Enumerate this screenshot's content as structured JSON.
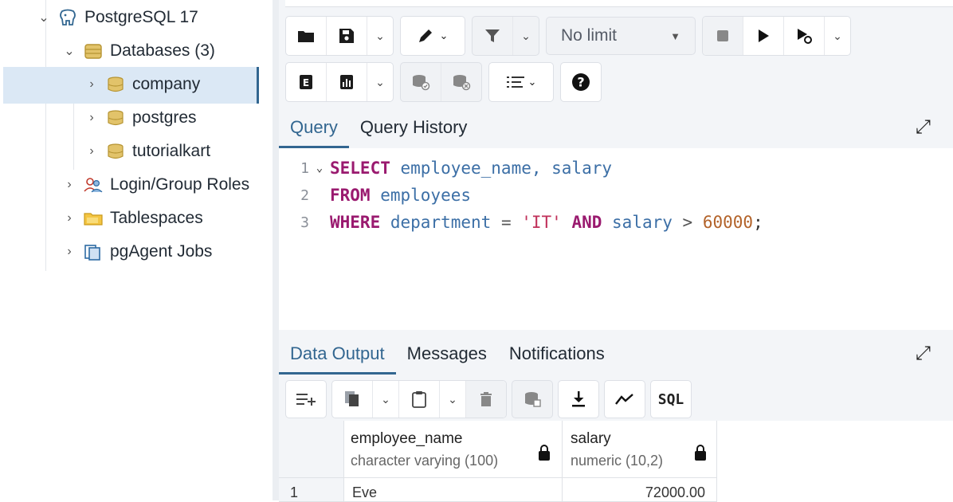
{
  "tree": {
    "server": "PostgreSQL 17",
    "databases": "Databases (3)",
    "db_items": [
      "company",
      "postgres",
      "tutorialkart"
    ],
    "login_roles": "Login/Group Roles",
    "tablespaces": "Tablespaces",
    "pgagent": "pgAgent Jobs"
  },
  "toolbar": {
    "limit": "No limit",
    "help": "?"
  },
  "query_tabs": {
    "query": "Query",
    "history": "Query History"
  },
  "editor": {
    "line_numbers": [
      "1",
      "2",
      "3"
    ],
    "line1": {
      "kw": "SELECT",
      "rest": " employee_name, salary"
    },
    "line2": {
      "kw": "FROM",
      "rest": " employees"
    },
    "line3": {
      "kw1": "WHERE",
      "id1": " department",
      "op1": " = ",
      "str": "'IT'",
      "kw2": " AND",
      "id2": " salary",
      "op2": " > ",
      "num": "60000",
      "end": ";"
    }
  },
  "output_tabs": {
    "data_output": "Data Output",
    "messages": "Messages",
    "notifications": "Notifications"
  },
  "output_toolbar": {
    "sql_label": "SQL"
  },
  "grid": {
    "columns": [
      {
        "name": "employee_name",
        "type": "character varying (100)"
      },
      {
        "name": "salary",
        "type": "numeric (10,2)"
      }
    ],
    "rows": [
      {
        "index": "1",
        "employee_name": "Eve",
        "salary": "72000.00"
      }
    ]
  },
  "colors": {
    "accent": "#326690",
    "selected_bg": "#dbe8f5"
  }
}
